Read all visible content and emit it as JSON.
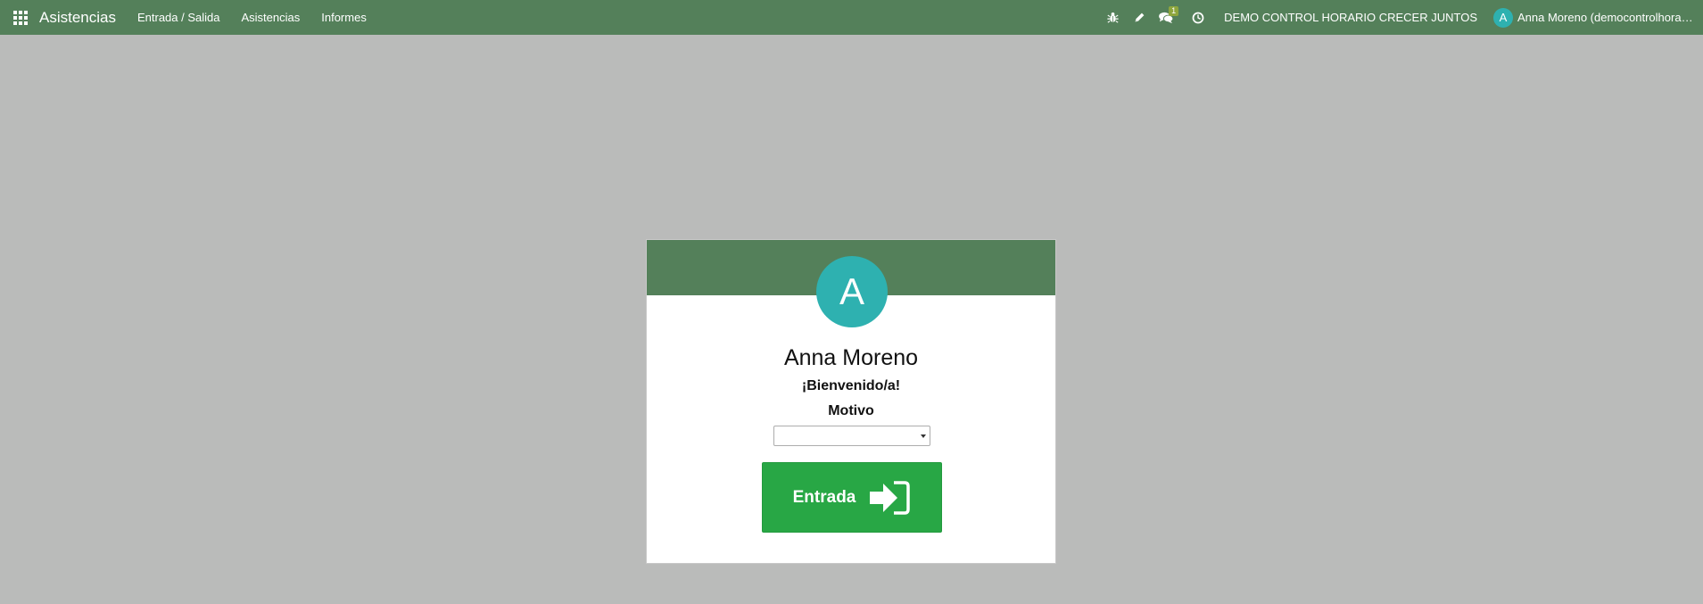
{
  "navbar": {
    "app_title": "Asistencias",
    "menu": [
      {
        "label": "Entrada / Salida"
      },
      {
        "label": "Asistencias"
      },
      {
        "label": "Informes"
      }
    ],
    "messages_badge": "1",
    "company": "DEMO CONTROL HORARIO CRECER JUNTOS",
    "user_initial": "A",
    "user_name": "Anna Moreno (democontrolhorariocrec..."
  },
  "icons": [
    "apps-grid-icon",
    "bug-icon",
    "pencil-icon",
    "chat-icon",
    "clock-icon",
    "sign-in-icon"
  ],
  "colors": {
    "navbar": "#54805a",
    "avatar": "#2eb1b0",
    "button": "#28a745",
    "background": "#babbba"
  },
  "card": {
    "avatar_initial": "A",
    "employee_name": "Anna Moreno",
    "welcome": "¡Bienvenido/a!",
    "motivo_label": "Motivo",
    "motivo_value": "",
    "button_label": "Entrada"
  }
}
